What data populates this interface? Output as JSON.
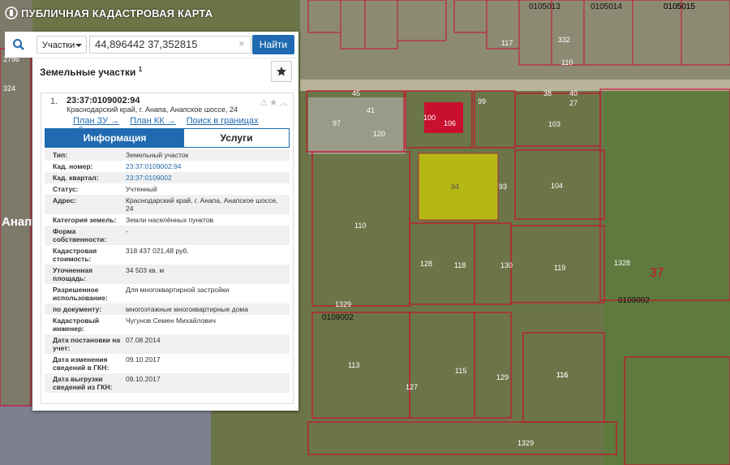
{
  "app": {
    "title": "ПУБЛИЧНАЯ КАДАСТРОВАЯ КАРТА"
  },
  "search": {
    "type_label": "Участки",
    "query": "44,896442 37,352815",
    "clear": "×",
    "find_label": "Найти"
  },
  "section": {
    "title": "Земельные участки",
    "count": "1"
  },
  "result": {
    "number": "1.",
    "cad_number": "23:37:0109002:94",
    "address": "Краснодарский край, г. Анапа, Анапское шоссе, 24",
    "links": [
      "План ЗУ →",
      "План КК →",
      "Поиск в границах объекта →"
    ],
    "tabs": [
      "Информация",
      "Услуги"
    ],
    "props": [
      {
        "k": "Тип:",
        "v": "Земельный участок"
      },
      {
        "k": "Кад. номер:",
        "v": "23:37:0109002:94"
      },
      {
        "k": "Кад. квартал:",
        "v": "23:37:0109002"
      },
      {
        "k": "Статус:",
        "v": "Учтенный"
      },
      {
        "k": "Адрес:",
        "v": "Краснодарский край, г. Анапа, Анапское шоссе, 24"
      },
      {
        "k": "Категория земель:",
        "v": "Земли населённых пунктов"
      },
      {
        "k": "Форма собственности:",
        "v": "-"
      },
      {
        "k": "Кадастровая стоимость:",
        "v": "318 437 021,48 руб."
      },
      {
        "k": "Уточненная площадь:",
        "v": "34 503 кв. м"
      },
      {
        "k": "Разрешенное использование:",
        "v": "Для многоквартирной застройки"
      },
      {
        "k": "по документу:",
        "v": "многоэтажные многоквартирные дома"
      },
      {
        "k": "Кадастровый инженер:",
        "v": "Чугунов Семен Михайлович"
      },
      {
        "k": "Дата постановки на учет:",
        "v": "07.08.2014"
      },
      {
        "k": "Дата изменения сведений в ГКН:",
        "v": "09.10.2017"
      },
      {
        "k": "Дата выгрузки сведений из ГКН:",
        "v": "09.10.2017"
      }
    ]
  },
  "map": {
    "labels": [
      "45",
      "41",
      "97",
      "120",
      "100",
      "106",
      "99",
      "103",
      "94",
      "93",
      "104",
      "110",
      "118",
      "128",
      "130",
      "119",
      "1328",
      "37",
      "116",
      "0109002",
      "1329",
      "0109002",
      "113",
      "115",
      "127",
      "129",
      "116",
      "1329",
      "0105013",
      "0105014",
      "0105015",
      "117",
      "332",
      "110",
      "40",
      "27",
      "38",
      "Анап",
      "324",
      "2796",
      "0105015"
    ]
  },
  "colors": {
    "accent": "#1f6ab0",
    "parcel": "#c8102e",
    "selected": "#d6d400"
  }
}
